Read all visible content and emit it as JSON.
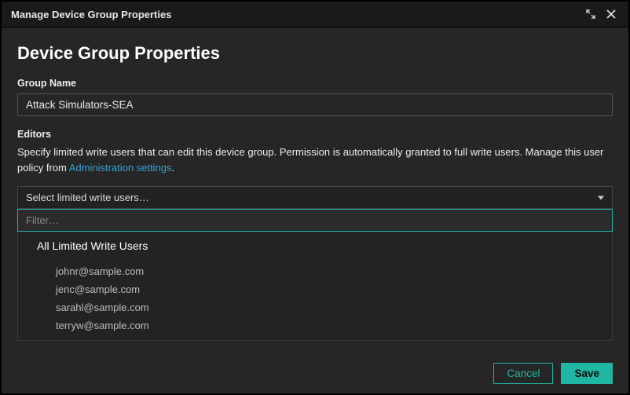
{
  "titlebar": {
    "title": "Manage Device Group Properties"
  },
  "page": {
    "heading": "Device Group Properties"
  },
  "group_name": {
    "label": "Group Name",
    "value": "Attack Simulators-SEA"
  },
  "editors": {
    "label": "Editors",
    "help_prefix": "Specify limited write users that can edit this device group. Permission is automatically granted to full write users. Manage this user policy from ",
    "help_link_text": "Administration settings",
    "help_suffix": ".",
    "dropdown_placeholder": "Select limited write users…",
    "filter_placeholder": "Filter…",
    "all_option_label": "All Limited Write Users",
    "options": [
      "johnr@sample.com",
      "jenc@sample.com",
      "sarahl@sample.com",
      "terryw@sample.com"
    ]
  },
  "footer": {
    "cancel": "Cancel",
    "save": "Save"
  }
}
